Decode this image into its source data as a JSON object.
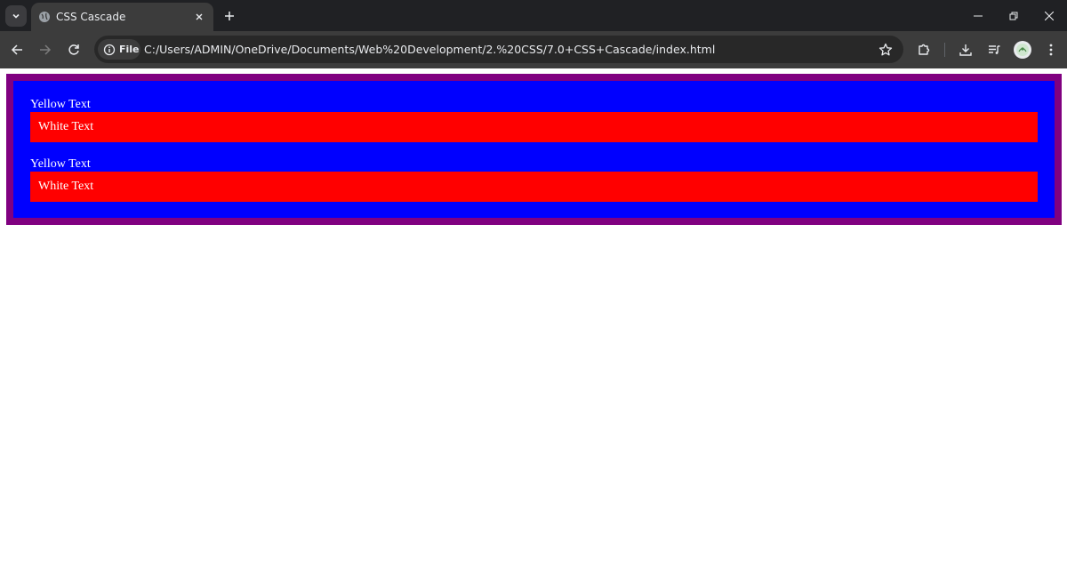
{
  "browser": {
    "tab": {
      "title": "CSS Cascade",
      "favicon": "globe-icon"
    },
    "address_bar": {
      "site_chip_label": "File",
      "url": "C:/Users/ADMIN/OneDrive/Documents/Web%20Development/2.%20CSS/7.0+CSS+Cascade/index.html"
    },
    "colors": {
      "chrome_dark": "#202124",
      "toolbar": "#3c3c3c",
      "omnibox": "#282828"
    }
  },
  "page": {
    "colors": {
      "outer_border": "#800080",
      "inner_box": "#0000ff",
      "red_box": "#ff0000",
      "text": "#ffffff"
    },
    "sections": [
      {
        "label": "Yellow Text",
        "box_text": "White Text"
      },
      {
        "label": "Yellow Text",
        "box_text": "White Text"
      }
    ]
  }
}
